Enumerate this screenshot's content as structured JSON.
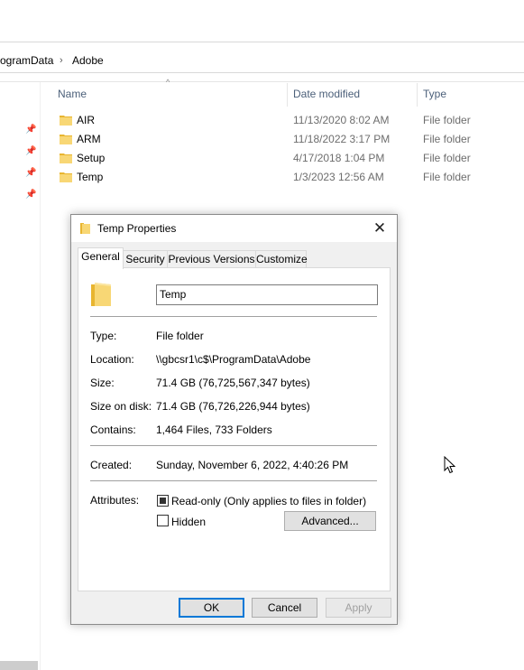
{
  "explorer": {
    "breadcrumb": [
      "ogramData",
      "Adobe"
    ],
    "columns": {
      "name": "Name",
      "date": "Date modified",
      "type": "Type"
    },
    "rows": [
      {
        "name": "AIR",
        "date": "11/13/2020 8:02 AM",
        "type": "File folder"
      },
      {
        "name": "ARM",
        "date": "11/18/2022 3:17 PM",
        "type": "File folder"
      },
      {
        "name": "Setup",
        "date": "4/17/2018 1:04 PM",
        "type": "File folder"
      },
      {
        "name": "Temp",
        "date": "1/3/2023 12:56 AM",
        "type": "File folder"
      }
    ]
  },
  "dialog": {
    "title": "Temp Properties",
    "close_glyph": "✕",
    "tabs": [
      "General",
      "Security",
      "Previous Versions",
      "Customize"
    ],
    "active_tab": "General",
    "folder_name": "Temp",
    "fields": {
      "type": {
        "label": "Type:",
        "value": "File folder"
      },
      "location": {
        "label": "Location:",
        "value": "\\\\gbcsr1\\c$\\ProgramData\\Adobe"
      },
      "size": {
        "label": "Size:",
        "value": "71.4 GB (76,725,567,347 bytes)"
      },
      "size_on_disk": {
        "label": "Size on disk:",
        "value": "71.4 GB (76,726,226,944 bytes)"
      },
      "contains": {
        "label": "Contains:",
        "value": "1,464 Files, 733 Folders"
      },
      "created": {
        "label": "Created:",
        "value": "Sunday, November 6, 2022, 4:40:26 PM"
      }
    },
    "attributes": {
      "label": "Attributes:",
      "readonly_label": "Read-only (Only applies to files in folder)",
      "readonly_state": "indeterminate",
      "hidden_label": "Hidden",
      "hidden_checked": false,
      "advanced_label": "Advanced..."
    },
    "buttons": {
      "ok": "OK",
      "cancel": "Cancel",
      "apply": "Apply"
    }
  },
  "colors": {
    "folder_yellow": "#f8d775",
    "folder_dark": "#e8b530",
    "accent": "#0078d7"
  }
}
